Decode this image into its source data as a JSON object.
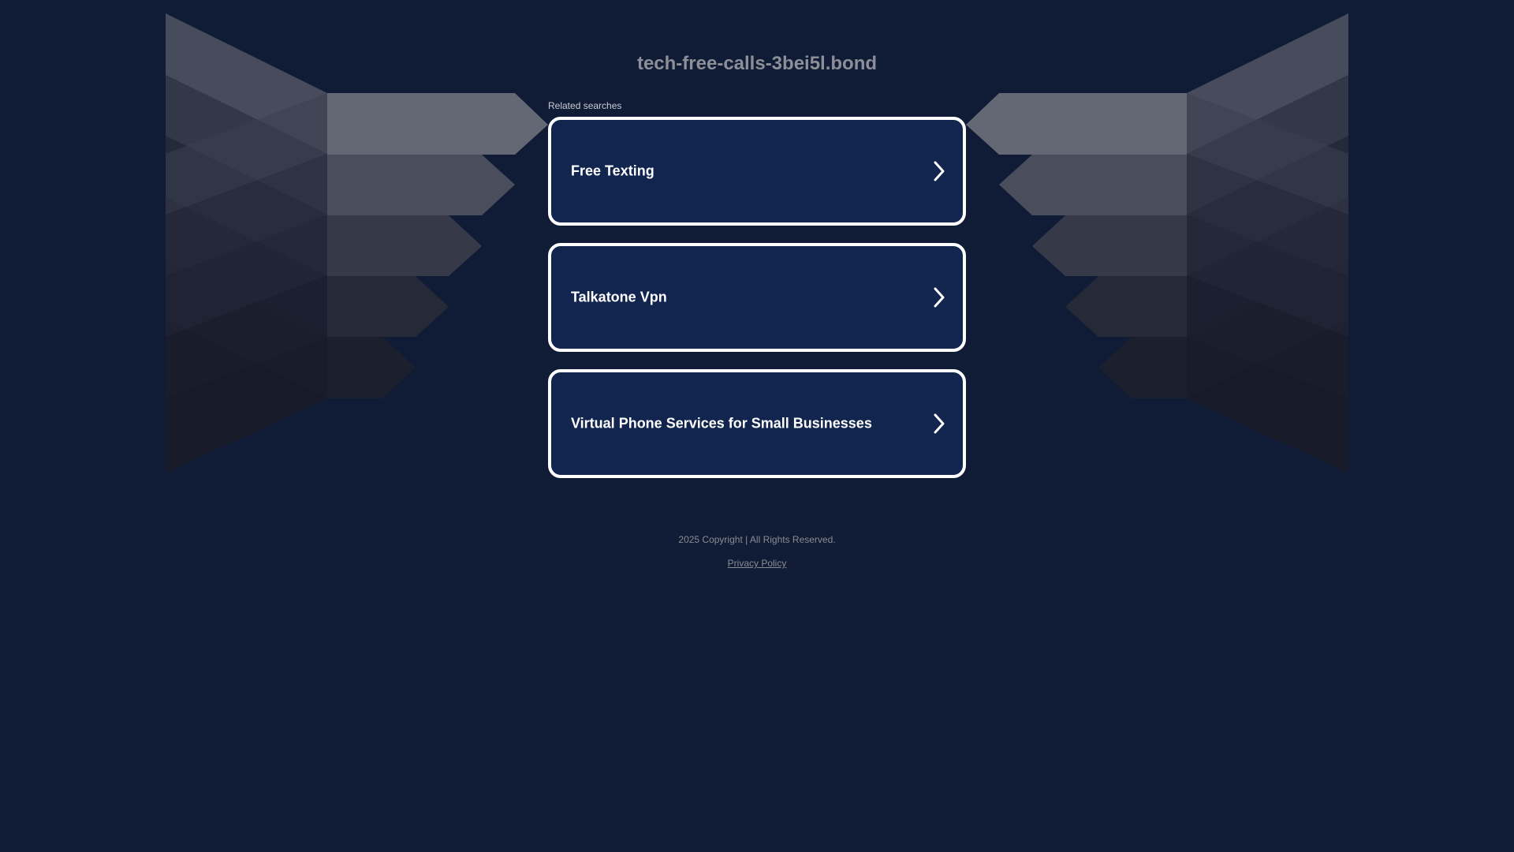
{
  "page": {
    "domain_title": "tech-free-calls-3bei5l.bond",
    "related_label": "Related searches"
  },
  "searches": [
    {
      "label": "Free Texting"
    },
    {
      "label": "Talkatone Vpn"
    },
    {
      "label": "Virtual Phone Services for Small Businesses"
    }
  ],
  "footer": {
    "copyright": "2025 Copyright | All Rights Reserved.",
    "privacy_link": "Privacy Policy"
  },
  "colors": {
    "background": "#101c36",
    "card_fill": "#11254f",
    "card_border": "#ffffff",
    "title_text": "#8c8f97"
  },
  "icons": {
    "card_arrow": "chevron-right-icon"
  }
}
